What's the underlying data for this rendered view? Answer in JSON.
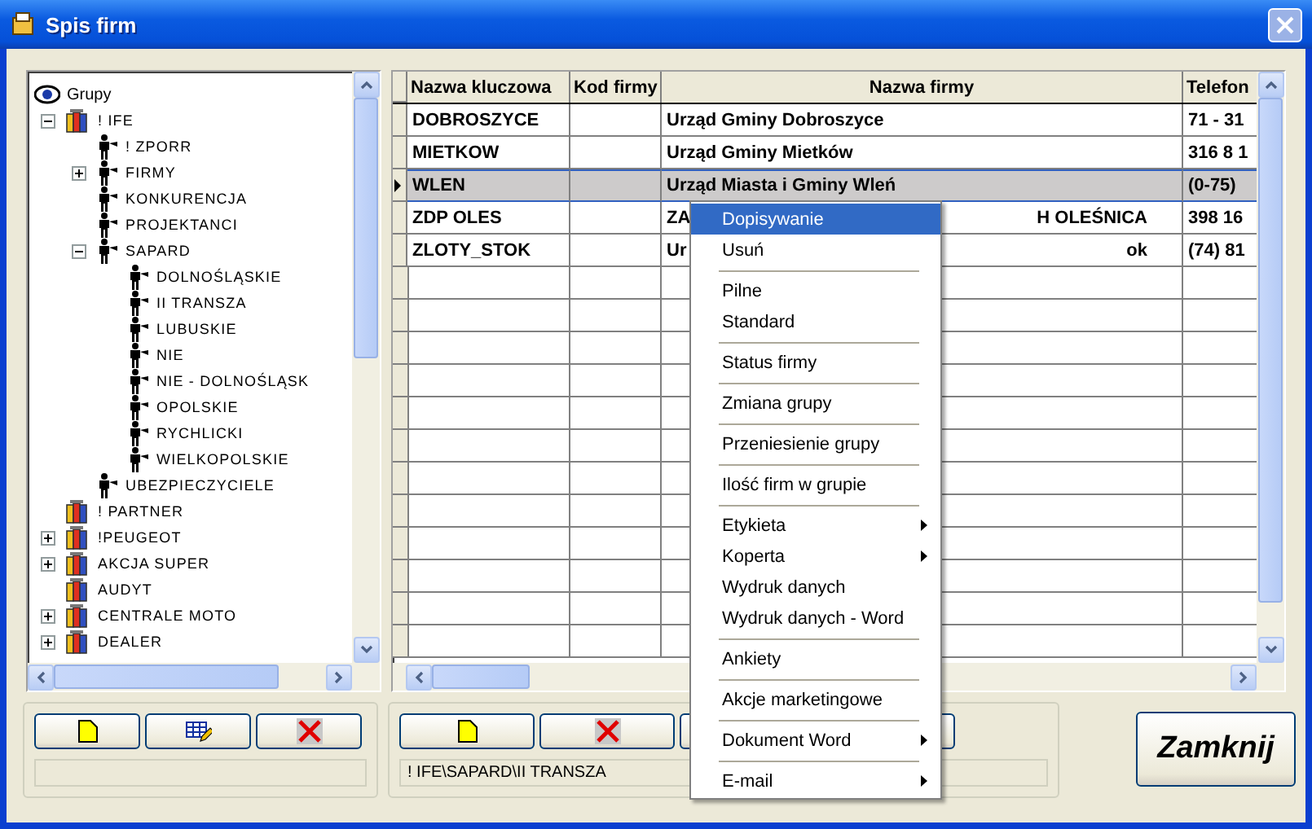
{
  "window": {
    "title": "Spis firm",
    "close_disabled": true
  },
  "tree": {
    "root": {
      "label": "Grupy",
      "kind": "root"
    },
    "items": [
      {
        "label": "! IFE",
        "kind": "group",
        "expanded": true,
        "children": [
          {
            "label": "! ZPORR",
            "kind": "person"
          },
          {
            "label": "FIRMY",
            "kind": "person",
            "expanded": false
          },
          {
            "label": "KONKURENCJA",
            "kind": "person"
          },
          {
            "label": "PROJEKTANCI",
            "kind": "person"
          },
          {
            "label": "SAPARD",
            "kind": "person",
            "expanded": true,
            "children": [
              {
                "label": "DOLNOŚLĄSKIE",
                "kind": "person"
              },
              {
                "label": "II TRANSZA",
                "kind": "person"
              },
              {
                "label": "LUBUSKIE",
                "kind": "person"
              },
              {
                "label": "NIE",
                "kind": "person"
              },
              {
                "label": "NIE - DOLNOŚLĄSK",
                "kind": "person"
              },
              {
                "label": "OPOLSKIE",
                "kind": "person"
              },
              {
                "label": "RYCHLICKI",
                "kind": "person"
              },
              {
                "label": "WIELKOPOLSKIE",
                "kind": "person"
              }
            ]
          },
          {
            "label": "UBEZPIECZYCIELE",
            "kind": "person"
          }
        ]
      },
      {
        "label": "! PARTNER",
        "kind": "group"
      },
      {
        "label": "!PEUGEOT",
        "kind": "group",
        "expanded": false
      },
      {
        "label": "AKCJA SUPER",
        "kind": "group",
        "expanded": false
      },
      {
        "label": "AUDYT",
        "kind": "group"
      },
      {
        "label": "CENTRALE MOTO",
        "kind": "group",
        "expanded": false
      },
      {
        "label": "DEALER",
        "kind": "group",
        "expanded": false
      }
    ]
  },
  "table": {
    "columns": [
      "Nazwa kluczowa",
      "Kod firmy",
      "Nazwa firmy",
      "Telefon"
    ],
    "rows": [
      {
        "key": "DOBROSZYCE",
        "name": [
          "Urząd Gminy Dobroszyce"
        ],
        "phone": "71 - 31",
        "selected": false
      },
      {
        "key": "MIETKOW",
        "name": [
          "Urząd Gminy Mietków"
        ],
        "phone": "316 8 1",
        "selected": false
      },
      {
        "key": "WLEN",
        "name": [
          "Urząd Miasta i Gminy Wleń"
        ],
        "phone": "(0-75)",
        "selected": true
      },
      {
        "key": "ZDP OLES",
        "name": [
          "ZA",
          "H OLEŚNICA"
        ],
        "phone": "398 16",
        "selected": false
      },
      {
        "key": "ZLOTY_STOK",
        "name": [
          "Ur",
          "ok"
        ],
        "phone": "(74) 81",
        "selected": false
      }
    ]
  },
  "context_menu": {
    "items": [
      {
        "kind": "item",
        "label": "Dopisywanie",
        "selected": true,
        "submenu": false
      },
      {
        "kind": "item",
        "label": "Usuń",
        "selected": false,
        "submenu": false
      },
      {
        "kind": "separator"
      },
      {
        "kind": "item",
        "label": "Pilne",
        "selected": false,
        "submenu": false
      },
      {
        "kind": "item",
        "label": "Standard",
        "selected": false,
        "submenu": false
      },
      {
        "kind": "separator"
      },
      {
        "kind": "item",
        "label": "Status firmy",
        "selected": false,
        "submenu": false
      },
      {
        "kind": "separator"
      },
      {
        "kind": "item",
        "label": "Zmiana grupy",
        "selected": false,
        "submenu": false
      },
      {
        "kind": "separator"
      },
      {
        "kind": "item",
        "label": "Przeniesienie grupy",
        "selected": false,
        "submenu": false
      },
      {
        "kind": "separator"
      },
      {
        "kind": "item",
        "label": "Ilość firm w grupie",
        "selected": false,
        "submenu": false
      },
      {
        "kind": "separator"
      },
      {
        "kind": "item",
        "label": "Etykieta",
        "selected": false,
        "submenu": true
      },
      {
        "kind": "item",
        "label": "Koperta",
        "selected": false,
        "submenu": true
      },
      {
        "kind": "item",
        "label": "Wydruk danych",
        "selected": false,
        "submenu": false
      },
      {
        "kind": "item",
        "label": "Wydruk danych - Word",
        "selected": false,
        "submenu": false
      },
      {
        "kind": "separator"
      },
      {
        "kind": "item",
        "label": "Ankiety",
        "selected": false,
        "submenu": false
      },
      {
        "kind": "separator"
      },
      {
        "kind": "item",
        "label": "Akcje marketingowe",
        "selected": false,
        "submenu": false
      },
      {
        "kind": "separator"
      },
      {
        "kind": "item",
        "label": "Dokument Word",
        "selected": false,
        "submenu": true
      },
      {
        "kind": "separator"
      },
      {
        "kind": "item",
        "label": "E-mail",
        "selected": false,
        "submenu": true
      }
    ]
  },
  "left_buttons": [
    {
      "kind": "new"
    },
    {
      "kind": "edit"
    },
    {
      "kind": "delete"
    }
  ],
  "right_buttons": [
    {
      "kind": "new"
    },
    {
      "kind": "delete"
    },
    {
      "kind": "blank"
    },
    {
      "kind": "blank"
    }
  ],
  "right_status": "! IFE\\SAPARD\\II TRANSZA",
  "close_button": "Zamknij"
}
